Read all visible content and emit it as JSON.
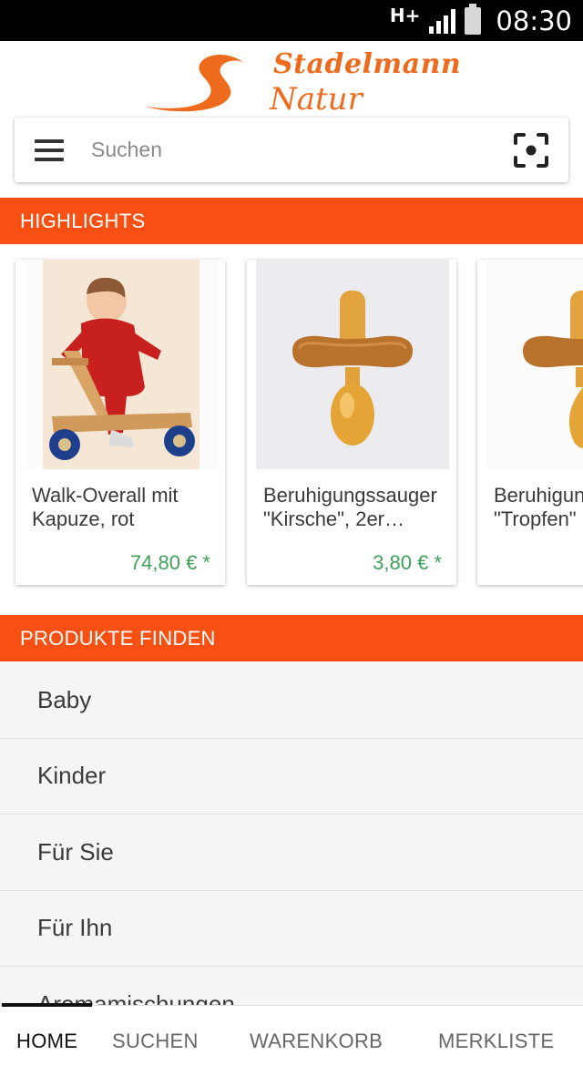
{
  "status_bar": {
    "network": "H+",
    "time": "08:30",
    "icons": [
      "signal-icon",
      "battery-icon"
    ]
  },
  "logo": {
    "line1": "Stadelmann",
    "line2": "Natur"
  },
  "search": {
    "placeholder": "Suchen",
    "icons": [
      "menu-icon",
      "scan-icon"
    ]
  },
  "highlights": {
    "header": "HIGHLIGHTS",
    "products": [
      {
        "title": "Walk-Overall mit Kapuze, rot",
        "price": "74,80 € *"
      },
      {
        "title": "Beruhigungssauger \"Kirsche\", 2er…",
        "price": "3,80 € *"
      },
      {
        "title": "Beruhigungssauger \"Tropfen\"",
        "price": ""
      }
    ]
  },
  "find_products": {
    "header": "PRODUKTE FINDEN",
    "categories": [
      "Baby",
      "Kinder",
      "Für Sie",
      "Für Ihn",
      "Aromamischungen"
    ]
  },
  "bottom_nav": {
    "tabs": [
      "HOME",
      "SUCHEN",
      "WARENKORB",
      "MERKLISTE"
    ],
    "active": "HOME"
  },
  "colors": {
    "accent": "#f75012",
    "logo": "#ee6b1d",
    "price": "#3fa05a"
  }
}
